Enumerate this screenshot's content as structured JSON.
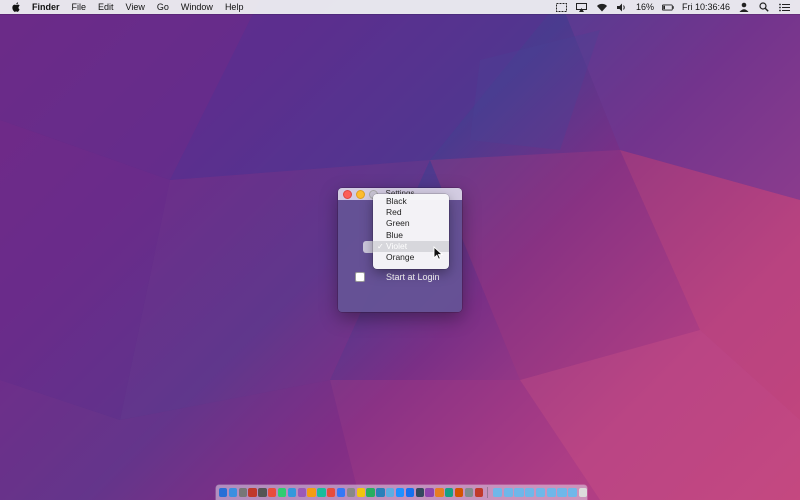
{
  "menubar": {
    "app_name": "Finder",
    "menus": [
      "File",
      "Edit",
      "View",
      "Go",
      "Window",
      "Help"
    ],
    "battery": "16%",
    "clock": "Fri 10:36:46",
    "status_icons": [
      "screen-sharing-icon",
      "airplay-icon",
      "wifi-icon",
      "volume-icon",
      "battery-icon",
      "user-icon",
      "spotlight-icon",
      "notification-center-icon"
    ]
  },
  "window": {
    "title": "Settings",
    "start_at_login_label": "Start at Login",
    "start_at_login_checked": false
  },
  "dropdown": {
    "options": [
      "Black",
      "Red",
      "Green",
      "Blue",
      "Violet",
      "Orange"
    ],
    "selected": "Violet",
    "check_mark": "✓"
  },
  "dock": {
    "colors": {
      "app_icons": [
        "#2a6fd6",
        "#3b8fe0",
        "#777777",
        "#c0392b",
        "#555555",
        "#e84d3c",
        "#2ecc71",
        "#3498db",
        "#9b59b6",
        "#f39c12",
        "#1abc9c",
        "#e74c3c",
        "#3478f6",
        "#888888",
        "#f1c40f",
        "#27ae60",
        "#2980b9",
        "#5dade2",
        "#1e90ff",
        "#1570ef",
        "#34495e",
        "#8e44ad",
        "#e67e22",
        "#16a085",
        "#d35400",
        "#7f8c8d",
        "#c0392b"
      ],
      "folder_icons": [
        "#6fb7e9",
        "#6fb7e9",
        "#6fb7e9",
        "#6fb7e9",
        "#6fb7e9",
        "#6fb7e9",
        "#6fb7e9",
        "#6fb7e9"
      ]
    }
  }
}
